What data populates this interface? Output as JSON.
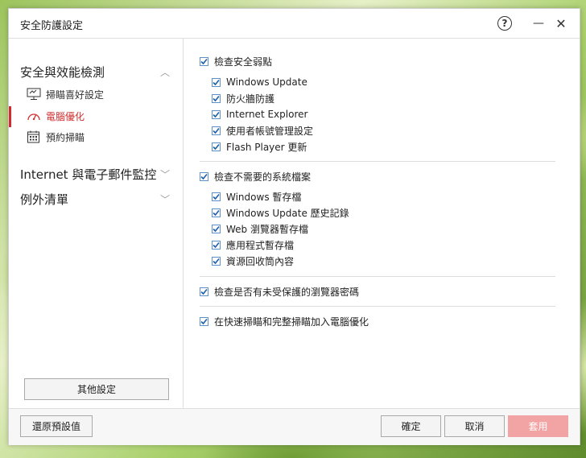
{
  "window": {
    "title": "安全防護設定"
  },
  "titlebar": {
    "help_glyph": "?",
    "minimize_glyph": "—",
    "close_glyph": "✕"
  },
  "sidebar": {
    "sections": [
      {
        "label": "安全與效能檢測",
        "expanded": true
      },
      {
        "label": "Internet 與電子郵件監控",
        "expanded": false
      },
      {
        "label": "例外清單",
        "expanded": false
      }
    ],
    "sub_items": [
      {
        "label": "掃瞄喜好設定",
        "icon": "monitor-icon",
        "active": false
      },
      {
        "label": "電腦優化",
        "icon": "gauge-icon",
        "active": true
      },
      {
        "label": "預約掃瞄",
        "icon": "calendar-icon",
        "active": false
      }
    ],
    "other_settings": "其他設定",
    "accent_color": "#d02e2e"
  },
  "content": {
    "group1": {
      "label": "檢查安全弱點",
      "checked": true,
      "items": [
        "Windows Update",
        "防火牆防護",
        "Internet Explorer",
        "使用者帳號管理設定",
        "Flash Player 更新"
      ]
    },
    "group2": {
      "label": "檢查不需要的系統檔案",
      "checked": true,
      "items": [
        "Windows 暫存檔",
        "Windows Update 歷史記錄",
        "Web 瀏覽器暫存檔",
        "應用程式暫存檔",
        "資源回收筒內容"
      ]
    },
    "option3": {
      "label": "檢查是否有未受保護的瀏覽器密碼",
      "checked": true
    },
    "option4": {
      "label": "在快速掃瞄和完整掃瞄加入電腦優化",
      "checked": true
    }
  },
  "footer": {
    "restore_defaults": "還原預設值",
    "ok": "確定",
    "cancel": "取消",
    "apply": "套用",
    "apply_color": "#f2a3a3"
  }
}
